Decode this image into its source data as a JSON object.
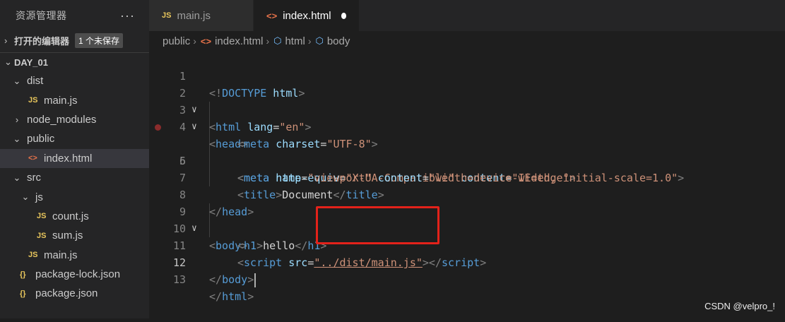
{
  "explorer": {
    "title": "资源管理器",
    "more_label": "···",
    "open_editors": {
      "label": "打开的编辑器",
      "badge": "1 个未保存"
    },
    "project": "DAY_01",
    "tree": [
      {
        "label": "dist",
        "kind": "folder",
        "expanded": true,
        "depth": 0
      },
      {
        "label": "main.js",
        "kind": "js",
        "depth": 1,
        "icon": "JS"
      },
      {
        "label": "node_modules",
        "kind": "folder",
        "expanded": false,
        "depth": 0
      },
      {
        "label": "public",
        "kind": "folder",
        "expanded": true,
        "depth": 0
      },
      {
        "label": "index.html",
        "kind": "html",
        "depth": 1,
        "icon": "<>",
        "active": true
      },
      {
        "label": "src",
        "kind": "folder",
        "expanded": true,
        "depth": 0
      },
      {
        "label": "js",
        "kind": "folder",
        "expanded": true,
        "depth": 1
      },
      {
        "label": "count.js",
        "kind": "js",
        "depth": 2,
        "icon": "JS"
      },
      {
        "label": "sum.js",
        "kind": "js",
        "depth": 2,
        "icon": "JS"
      },
      {
        "label": "main.js",
        "kind": "js",
        "depth": 1,
        "icon": "JS"
      },
      {
        "label": "package-lock.json",
        "kind": "json",
        "depth": 0,
        "icon": "{}"
      },
      {
        "label": "package.json",
        "kind": "json",
        "depth": 0,
        "icon": "{}"
      }
    ]
  },
  "tabs": [
    {
      "label": "main.js",
      "icon": "JS",
      "active": false
    },
    {
      "label": "index.html",
      "icon": "<>",
      "active": true,
      "dirty": true
    }
  ],
  "breadcrumb": [
    "public",
    "index.html",
    "html",
    "body"
  ],
  "editor": {
    "current_line": 12,
    "breakpoint_line": 5,
    "lines": [
      {
        "n": "1",
        "fold": ""
      },
      {
        "n": "2",
        "fold": "∨"
      },
      {
        "n": "3",
        "fold": "∨"
      },
      {
        "n": "4",
        "fold": ""
      },
      {
        "n": "5",
        "fold": ""
      },
      {
        "n": "6",
        "fold": ""
      },
      {
        "n": "7",
        "fold": ""
      },
      {
        "n": "8",
        "fold": ""
      },
      {
        "n": "9",
        "fold": "∨"
      },
      {
        "n": "10",
        "fold": ""
      },
      {
        "n": "11",
        "fold": ""
      },
      {
        "n": "12",
        "fold": ""
      },
      {
        "n": "13",
        "fold": ""
      }
    ],
    "code": {
      "l1": {
        "open": "<!",
        "kw": "DOCTYPE",
        "name": " html",
        "close": ">"
      },
      "l2": {
        "tag": "html",
        "attr": "lang",
        "val": "\"en\""
      },
      "l3": {
        "tag": "head"
      },
      "l4": {
        "tag": "meta",
        "attr": "charset",
        "val": "\"UTF-8\""
      },
      "l5": {
        "tag": "meta",
        "attr1": "http-equiv",
        "val1": "\"X-UA-Compatible\"",
        "attr2": "content",
        "val2": "\"IE=edge\""
      },
      "l6": {
        "tag": "meta",
        "attr1": "name",
        "val1": "\"viewport\"",
        "attr2": "content",
        "val2": "\"width=device-width, initial-scale=1.0\""
      },
      "l7": {
        "tag": "title",
        "text": "Document"
      },
      "l8": {
        "tag": "head"
      },
      "l9": {
        "tag": "body"
      },
      "l10": {
        "tag": "h1",
        "text": "hello"
      },
      "l11": {
        "tag": "script",
        "attr": "src",
        "val": "\"../dist/main.js\""
      },
      "l12": {
        "tag": "body"
      },
      "l13": {
        "tag": "html"
      }
    }
  },
  "watermark": "CSDN @velpro_!"
}
